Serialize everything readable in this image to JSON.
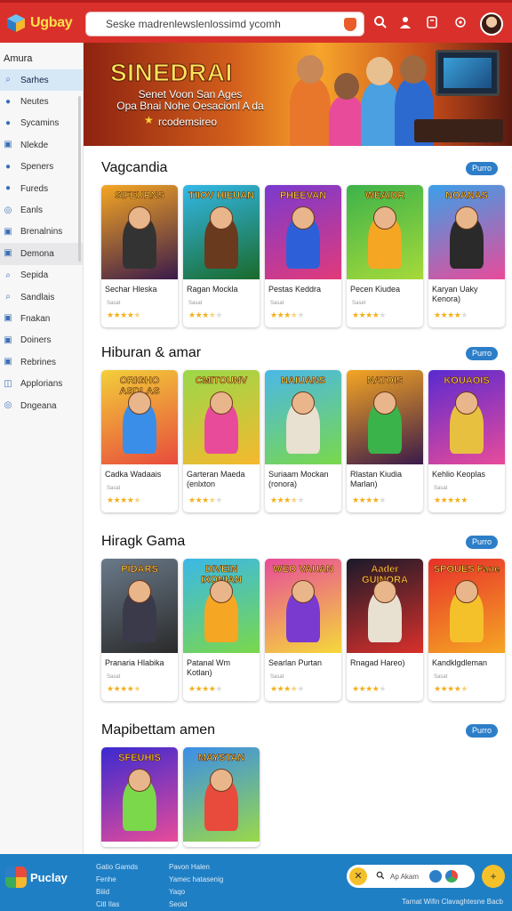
{
  "header": {
    "logo_text": "Ugbay",
    "search_text": "Seske madrenlewslenlossimd ycomh"
  },
  "sidebar": {
    "heading": "Amura",
    "items": [
      {
        "label": "Sarhes",
        "icon": "search-icon"
      },
      {
        "label": "Neutes",
        "icon": "dot-icon"
      },
      {
        "label": "Sycamins",
        "icon": "dot-icon"
      },
      {
        "label": "Nlekde",
        "icon": "box-icon"
      },
      {
        "label": "Speners",
        "icon": "dot-icon"
      },
      {
        "label": "Fureds",
        "icon": "dot-icon"
      },
      {
        "label": "Eanls",
        "icon": "circle-icon"
      },
      {
        "label": "Brenalnins",
        "icon": "box-icon"
      },
      {
        "label": "Demona",
        "icon": "box-icon"
      },
      {
        "label": "Sepida",
        "icon": "search-icon"
      },
      {
        "label": "Sandlais",
        "icon": "search-icon"
      },
      {
        "label": "Fnakan",
        "icon": "box-icon"
      },
      {
        "label": "Doiners",
        "icon": "box-icon"
      },
      {
        "label": "Rebrines",
        "icon": "box-icon"
      },
      {
        "label": "Applorians",
        "icon": "bag-icon"
      },
      {
        "label": "Dngeana",
        "icon": "circle-icon"
      }
    ]
  },
  "banner": {
    "title": "SINEDRAI",
    "subtitle_line1": "Senet Voon San Ages",
    "subtitle_line2": "Opa Bnai Nohe Oesacionl A da",
    "link": "rcodemsireo"
  },
  "sections": [
    {
      "title": "Vagcandia",
      "pill": "Purro",
      "cards": [
        {
          "art": "SIFEURNS",
          "name": "Sechar Hleska",
          "sub": "Sasat",
          "rating": 4.5,
          "bg": [
            "#f5a623",
            "#3a1a4a"
          ],
          "char": "#333"
        },
        {
          "art": "TIIOV HIEUAN",
          "name": "Ragan Mockla",
          "sub": "Sasat",
          "rating": 3.5,
          "bg": [
            "#33b8e8",
            "#1a6a2a"
          ],
          "char": "#6a3a1e"
        },
        {
          "art": "PHEEVAN",
          "name": "Pestas Keddra",
          "sub": "Sasat",
          "rating": 3.5,
          "bg": [
            "#7a3ad0",
            "#e23a7a"
          ],
          "char": "#2d60d8"
        },
        {
          "art": "WEAIDR",
          "name": "Pecen Kiudea",
          "sub": "Saset",
          "rating": 4,
          "bg": [
            "#3cb34a",
            "#a6d93a"
          ],
          "char": "#f5a623"
        },
        {
          "art": "NOANAS",
          "name": "Karyan Uaky Kenora)",
          "sub": "",
          "rating": 4,
          "bg": [
            "#3aa0e8",
            "#e84b9a"
          ],
          "char": "#2a2a2a"
        }
      ]
    },
    {
      "title": "Hiburan & amar",
      "pill": "Purro",
      "cards": [
        {
          "art": "ORIGHO ASDLAS",
          "name": "Cadka Wadaais",
          "sub": "Sasat",
          "rating": 4.5,
          "bg": [
            "#f2cf3a",
            "#e84b3c"
          ],
          "char": "#3a8ee8"
        },
        {
          "art": "CMITOUNV",
          "name": "Garteran Maeda (enlxton",
          "sub": "",
          "rating": 3.5,
          "bg": [
            "#9ad84a",
            "#f5b82e"
          ],
          "char": "#e84b9a"
        },
        {
          "art": "NAIUANS",
          "name": "Suriaam Mockan (ronora)",
          "sub": "",
          "rating": 3.5,
          "bg": [
            "#4ab8e8",
            "#7ad84a"
          ],
          "char": "#e8e0d0"
        },
        {
          "art": "NATOIS",
          "name": "Rlastan Kiudia Marlan)",
          "sub": "",
          "rating": 4,
          "bg": [
            "#f5a623",
            "#3a1a4a"
          ],
          "char": "#3ab34a"
        },
        {
          "art": "KOUAOIS",
          "name": "Kehlio Keoplas",
          "sub": "Sasat",
          "rating": 5,
          "bg": [
            "#5a2ad0",
            "#e84b9a"
          ],
          "char": "#e8c040"
        }
      ]
    },
    {
      "title": "Hiragk Gama",
      "pill": "Purro",
      "cards": [
        {
          "art": "PIDARS",
          "name": "Pranaria Hlabika",
          "sub": "Sasat",
          "rating": 4.5,
          "bg": [
            "#6a7a8a",
            "#2a2a2a"
          ],
          "char": "#3a3a4a"
        },
        {
          "art": "DIVEIN IXONIAN",
          "name": "Patanal Wm Kotlan)",
          "sub": "",
          "rating": 4,
          "bg": [
            "#3ab8e8",
            "#7ad84a"
          ],
          "char": "#f5a623"
        },
        {
          "art": "WEO VAUAN",
          "name": "Searlan Purtan",
          "sub": "Sasat",
          "rating": 3.5,
          "bg": [
            "#e84b9a",
            "#f5d83a"
          ],
          "char": "#7a3ad0"
        },
        {
          "art": "Aader GUINORA",
          "name": "Rnagad Hareo)",
          "sub": "",
          "rating": 4,
          "bg": [
            "#1a1a2a",
            "#d9302b"
          ],
          "char": "#e8e0d0"
        },
        {
          "art": "SPOUES Fane",
          "name": "Kandklgdleman",
          "sub": "Sasat",
          "rating": 4.5,
          "bg": [
            "#e8302b",
            "#f5a623"
          ],
          "char": "#f5c12b"
        }
      ]
    },
    {
      "title": "Mapibettam amen",
      "pill": "Purro",
      "cards": [
        {
          "art": "SFEUHIS",
          "name": "",
          "sub": "",
          "rating": 0,
          "bg": [
            "#3a2ad0",
            "#e84b9a"
          ],
          "char": "#7ad84a"
        },
        {
          "art": "MAYSTAN",
          "name": "",
          "sub": "",
          "rating": 0,
          "bg": [
            "#3a8ee8",
            "#9ad84a"
          ],
          "char": "#e84b3c"
        }
      ]
    }
  ],
  "footer": {
    "app_name": "Puclay",
    "col1": [
      "Gatio Gamds",
      "Fenhe",
      "Biiid",
      "Citl Ilas"
    ],
    "col2": [
      "Pavon Halen",
      "Yamec hatasenig",
      "Yaqo",
      "Seoid"
    ],
    "search_placeholder": "Ap Akam",
    "copyright": "Tarnat Wifin Clavaghtesne Bacb"
  },
  "colors": {
    "topbar": "#d9302b",
    "accent": "#2d7ec8",
    "footer": "#1f7fc4",
    "star": "#f2b01e"
  }
}
